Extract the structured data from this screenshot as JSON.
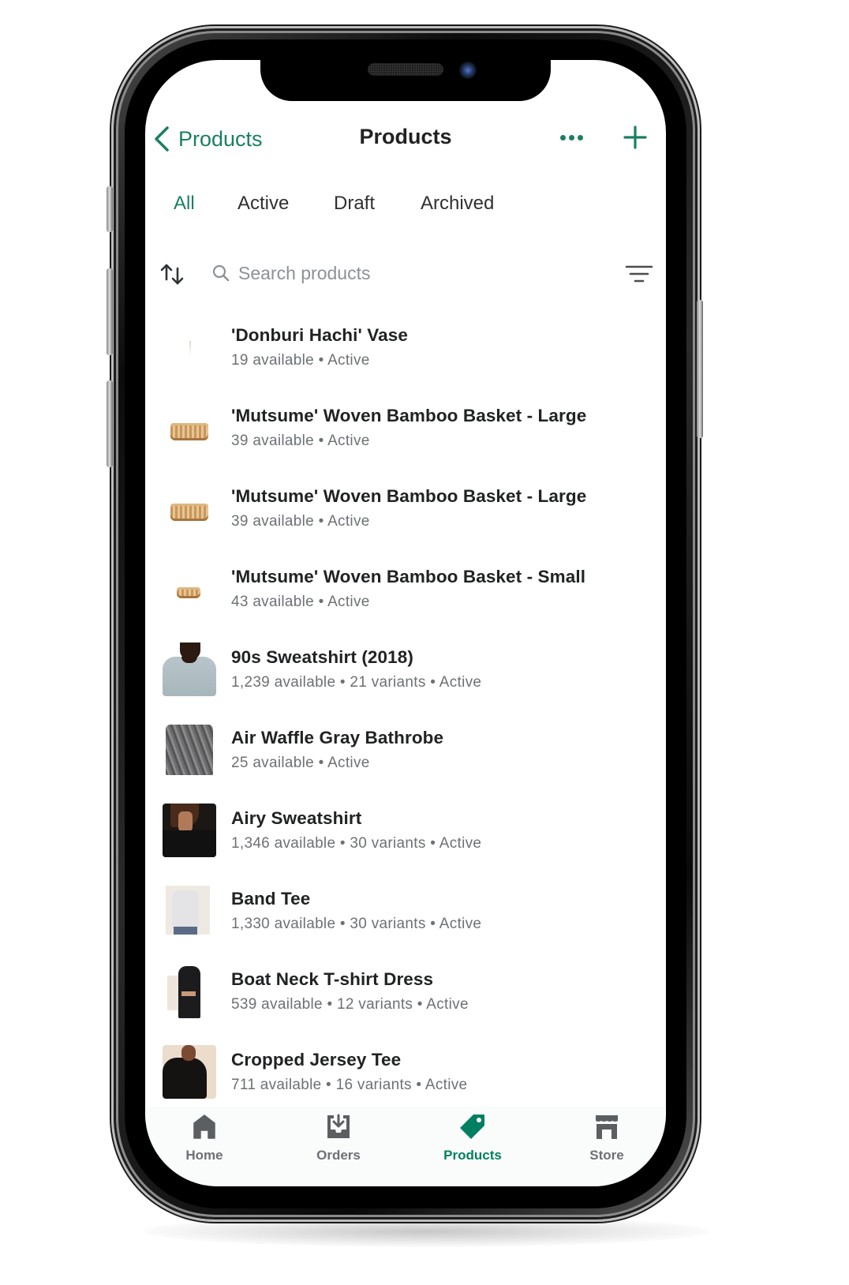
{
  "nav": {
    "back_label": "Products",
    "title": "Products"
  },
  "tabs": [
    {
      "label": "All",
      "active": true
    },
    {
      "label": "Active",
      "active": false
    },
    {
      "label": "Draft",
      "active": false
    },
    {
      "label": "Archived",
      "active": false
    }
  ],
  "search": {
    "placeholder": "Search products",
    "value": ""
  },
  "products": [
    {
      "name": "'Donburi Hachi' Vase",
      "meta": "19 available • Active",
      "thumb": "vase"
    },
    {
      "name": "'Mutsume' Woven Bamboo Basket - Large",
      "meta": "39 available • Active",
      "thumb": "basket-large"
    },
    {
      "name": "'Mutsume' Woven Bamboo Basket - Large",
      "meta": "39 available • Active",
      "thumb": "basket-large"
    },
    {
      "name": "'Mutsume' Woven Bamboo Basket - Small",
      "meta": "43 available • Active",
      "thumb": "basket-small"
    },
    {
      "name": "90s Sweatshirt (2018)",
      "meta": "1,239 available • 21 variants • Active",
      "thumb": "sweatshirt"
    },
    {
      "name": "Air Waffle Gray Bathrobe",
      "meta": "25 available • Active",
      "thumb": "bathrobe"
    },
    {
      "name": "Airy Sweatshirt",
      "meta": "1,346 available • 30 variants • Active",
      "thumb": "airy"
    },
    {
      "name": "Band Tee",
      "meta": "1,330 available • 30 variants • Active",
      "thumb": "bandtee"
    },
    {
      "name": "Boat Neck T-shirt Dress",
      "meta": "539 available • 12 variants • Active",
      "thumb": "dress"
    },
    {
      "name": "Cropped Jersey Tee",
      "meta": "711 available • 16 variants • Active",
      "thumb": "cropped"
    }
  ],
  "tabbar": [
    {
      "label": "Home",
      "icon": "home-icon",
      "active": false
    },
    {
      "label": "Orders",
      "icon": "orders-inbox-icon",
      "active": false
    },
    {
      "label": "Products",
      "icon": "tag-icon",
      "active": true
    },
    {
      "label": "Store",
      "icon": "store-icon",
      "active": false
    }
  ],
  "colors": {
    "accent": "#008060",
    "text": "#202223",
    "subdued": "#6d7175",
    "icon_gray": "#5c5f62"
  }
}
